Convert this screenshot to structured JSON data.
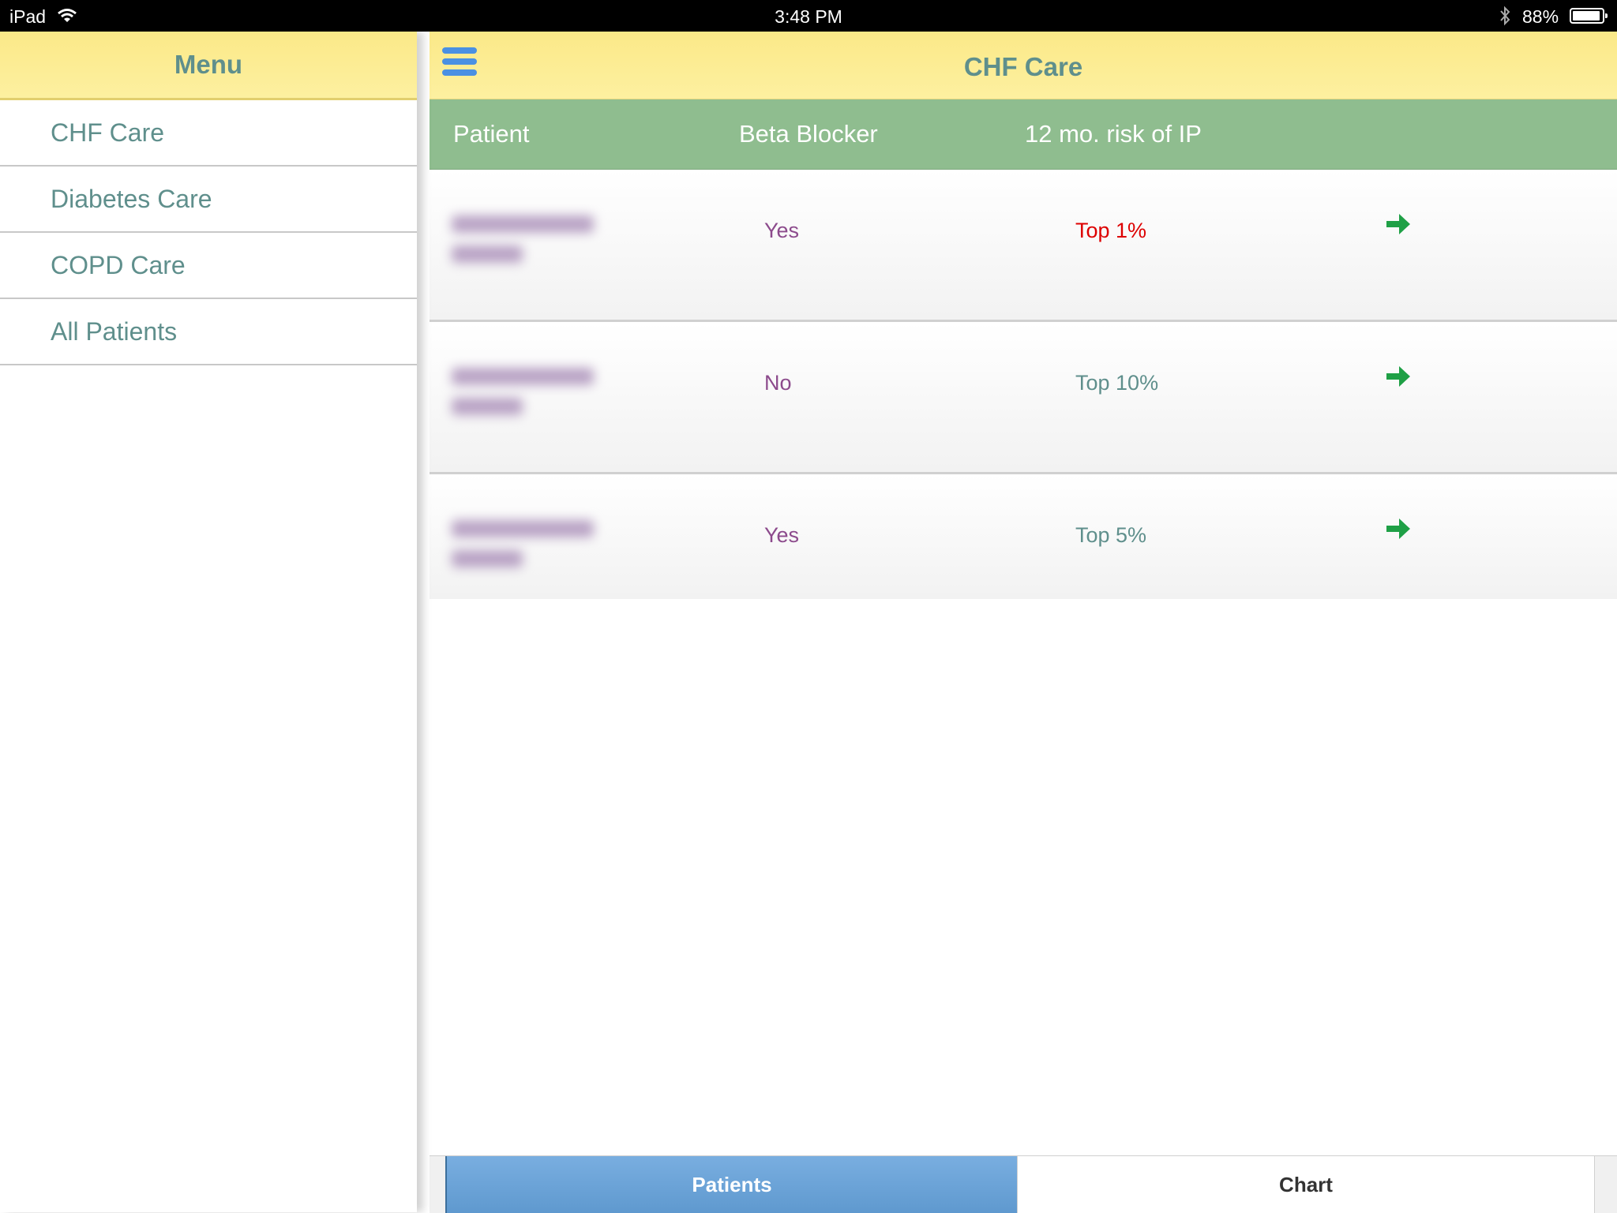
{
  "status_bar": {
    "device": "iPad",
    "time": "3:48 PM",
    "battery": "88%"
  },
  "sidebar": {
    "title": "Menu",
    "items": [
      {
        "label": "CHF Care"
      },
      {
        "label": "Diabetes Care"
      },
      {
        "label": "COPD Care"
      },
      {
        "label": "All Patients"
      }
    ]
  },
  "main": {
    "title": "CHF Care",
    "columns": {
      "patient": "Patient",
      "beta_blocker": "Beta Blocker",
      "risk": "12 mo. risk of IP"
    },
    "rows": [
      {
        "beta_blocker": "Yes",
        "risk": "Top 1%",
        "risk_color": "#dd0000"
      },
      {
        "beta_blocker": "No",
        "risk": "Top 10%",
        "risk_color": "#5f8f8c"
      },
      {
        "beta_blocker": "Yes",
        "risk": "Top 5%",
        "risk_color": "#5f8f8c"
      }
    ]
  },
  "tabs": {
    "patients": "Patients",
    "chart": "Chart"
  },
  "colors": {
    "header_yellow": "#fbe988",
    "table_header_green": "#8fbd8f",
    "teal_text": "#5f8f8c",
    "purple_text": "#8c4a8c",
    "alert_red": "#dd0000",
    "arrow_green": "#1fa046",
    "tab_blue": "#6aa4d8"
  },
  "icons": {
    "menu": "hamburger-menu-icon",
    "row_action": "arrow-right-icon",
    "wifi": "wifi-icon",
    "bluetooth": "bluetooth-icon",
    "battery": "battery-icon"
  }
}
